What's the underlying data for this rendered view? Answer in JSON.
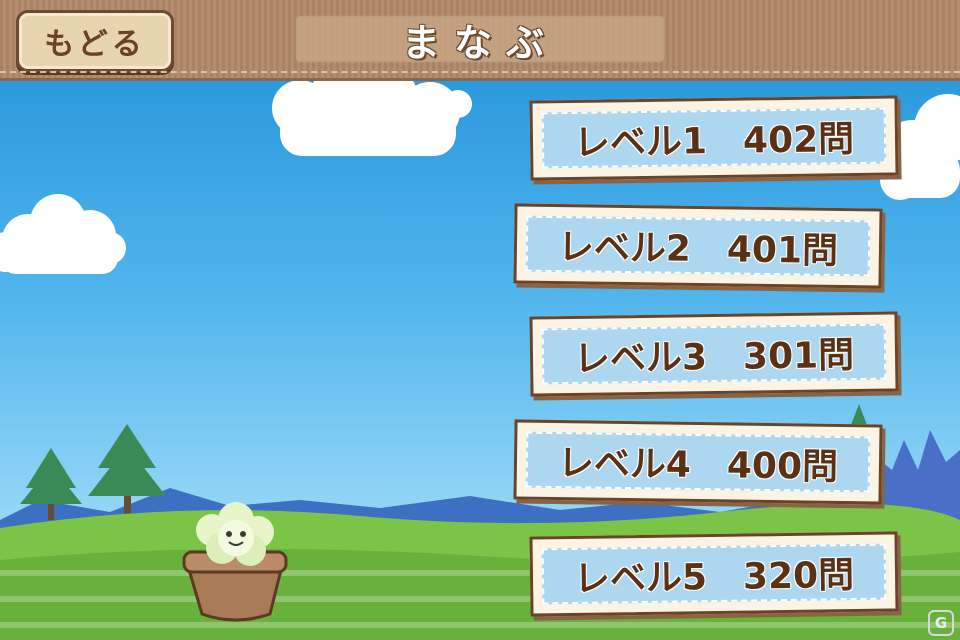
{
  "header": {
    "back_label": "もどる",
    "title": "まなぶ"
  },
  "levels": [
    {
      "name": "レベル1",
      "count": "402問"
    },
    {
      "name": "レベル2",
      "count": "401問"
    },
    {
      "name": "レベル3",
      "count": "301問"
    },
    {
      "name": "レベル4",
      "count": "400問"
    },
    {
      "name": "レベル5",
      "count": "320問"
    }
  ],
  "colors": {
    "header_brown": "#a98363",
    "button_text_brown": "#5a3115",
    "button_inner_blue": "#acd7ee",
    "sky_blue": "#4fb4ec",
    "grass_green": "#7cc447"
  },
  "icons": {
    "mascot": "plant-pot-mascot-icon",
    "watermark": "g-logo-icon"
  }
}
